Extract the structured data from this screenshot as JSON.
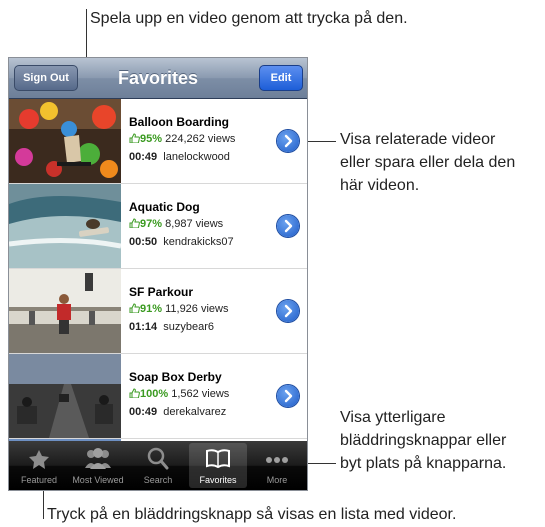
{
  "callouts": {
    "top": "Spela upp en video genom att trycka på den.",
    "right_1": "Visa relaterade videor",
    "right_2": "eller spara eller dela den",
    "right_3": "här videon.",
    "more_1": "Visa ytterligare",
    "more_2": "bläddringsknappar eller",
    "more_3": "byt plats på knapparna.",
    "bottom": "Tryck på en bläddringsknapp så visas en lista med videor."
  },
  "navbar": {
    "title": "Favorites",
    "left_button": "Sign Out",
    "right_button": "Edit"
  },
  "videos": [
    {
      "title": "Balloon Boarding",
      "rating": "95%",
      "views": "224,262 views",
      "duration": "00:49",
      "user": "lanelockwood"
    },
    {
      "title": "Aquatic Dog",
      "rating": "97%",
      "views": "8,987 views",
      "duration": "00:50",
      "user": "kendrakicks07"
    },
    {
      "title": "SF Parkour",
      "rating": "91%",
      "views": "11,926 views",
      "duration": "01:14",
      "user": "suzybear6"
    },
    {
      "title": "Soap Box Derby",
      "rating": "100%",
      "views": "1,562 views",
      "duration": "00:49",
      "user": "derekalvarez"
    }
  ],
  "tabs": [
    {
      "label": "Featured",
      "icon": "featured-icon"
    },
    {
      "label": "Most Viewed",
      "icon": "most-viewed-icon"
    },
    {
      "label": "Search",
      "icon": "search-icon"
    },
    {
      "label": "Favorites",
      "icon": "favorites-icon",
      "selected": true
    },
    {
      "label": "More",
      "icon": "more-icon"
    }
  ],
  "colors": {
    "accent": "#1e5cc8",
    "rating_green": "#3a9a20",
    "navbar": "#7d8ea6"
  }
}
